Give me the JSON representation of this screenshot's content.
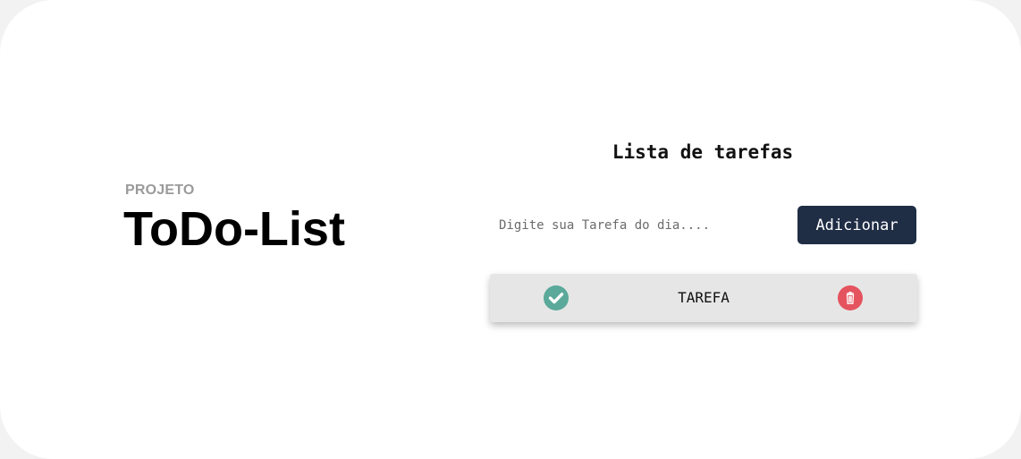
{
  "header": {
    "eyebrow": "PROJETO",
    "title": "ToDo-List"
  },
  "todo": {
    "title": "Lista de tarefas",
    "input": {
      "placeholder": "Digite sua Tarefa do dia....",
      "value": ""
    },
    "add_label": "Adicionar",
    "tasks": [
      {
        "label": "TAREFA",
        "complete_icon": "check-circle-icon",
        "delete_icon": "trash-icon"
      }
    ]
  },
  "colors": {
    "button_bg": "#1f2d45",
    "check_green": "#5aa99a",
    "delete_red": "#e5535f",
    "task_bg": "#e6e6e6"
  }
}
